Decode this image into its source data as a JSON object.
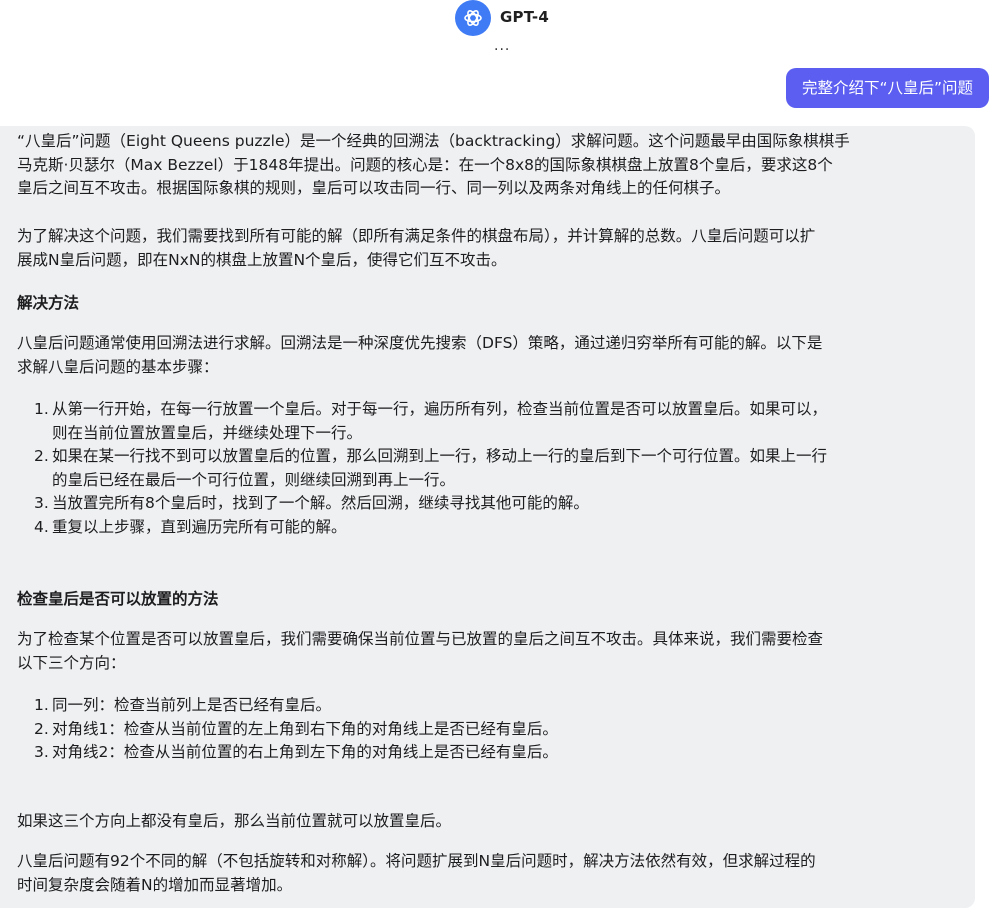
{
  "header": {
    "model_name": "GPT-4",
    "status": "...",
    "logo_icon": "openai-logo-icon",
    "accent_color": "#3e7bf5"
  },
  "user_message": {
    "text": "完整介绍下“八皇后”问题",
    "bubble_color": "#5b5ef0"
  },
  "assistant_message": {
    "bubble_color": "#eef0f2",
    "intro_lines": [
      "“八皇后”问题（Eight Queens puzzle）是一个经典的回溯法（backtracking）求解问题。这个问题最早由国际象棋棋手",
      "马克斯·贝瑟尔（Max Bezzel）于1848年提出。问题的核心是：在一个8x8的国际象棋棋盘上放置8个皇后，要求这8个",
      "皇后之间互不攻击。根据国际象棋的规则，皇后可以攻击同一行、同一列以及两条对角线上的任何棋子。"
    ],
    "goal_lines": [
      "为了解决这个问题，我们需要找到所有可能的解（即所有满足条件的棋盘布局），并计算解的总数。八皇后问题可以扩",
      "展成N皇后问题，即在NxN的棋盘上放置N个皇后，使得它们互不攻击。"
    ],
    "section1_heading": "解决方法",
    "method_lines": [
      "八皇后问题通常使用回溯法进行求解。回溯法是一种深度优先搜索（DFS）策略，通过递归穷举所有可能的解。以下是",
      "求解八皇后问题的基本步骤："
    ],
    "steps": [
      {
        "num": "1.",
        "lines": [
          "从第一行开始，在每一行放置一个皇后。对于每一行，遍历所有列，检查当前位置是否可以放置皇后。如果可以，",
          "则在当前位置放置皇后，并继续处理下一行。"
        ]
      },
      {
        "num": "2.",
        "lines": [
          "如果在某一行找不到可以放置皇后的位置，那么回溯到上一行，移动上一行的皇后到下一个可行位置。如果上一行",
          "的皇后已经在最后一个可行位置，则继续回溯到再上一行。"
        ]
      },
      {
        "num": "3.",
        "lines": [
          "当放置完所有8个皇后时，找到了一个解。然后回溯，继续寻找其他可能的解。"
        ]
      },
      {
        "num": "4.",
        "lines": [
          "重复以上步骤，直到遍历完所有可能的解。"
        ]
      }
    ],
    "section2_heading": "检查皇后是否可以放置的方法",
    "check_lines": [
      "为了检查某个位置是否可以放置皇后，我们需要确保当前位置与已放置的皇后之间互不攻击。具体来说，我们需要检查",
      "以下三个方向："
    ],
    "directions": [
      {
        "num": "1.",
        "text": "同一列：检查当前列上是否已经有皇后。"
      },
      {
        "num": "2.",
        "text": "对角线1：检查从当前位置的左上角到右下角的对角线上是否已经有皇后。"
      },
      {
        "num": "3.",
        "text": "对角线2：检查从当前位置的右上角到左下角的对角线上是否已经有皇后。"
      }
    ],
    "conclusion": "如果这三个方向上都没有皇后，那么当前位置就可以放置皇后。",
    "final_lines": [
      "八皇后问题有92个不同的解（不包括旋转和对称解）。将问题扩展到N皇后问题时，解决方法依然有效，但求解过程的",
      "时间复杂度会随着N的增加而显著增加。"
    ]
  }
}
